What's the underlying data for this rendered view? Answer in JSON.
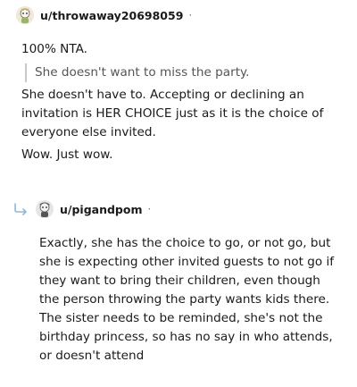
{
  "comment1": {
    "username": "u/throwaway20698059",
    "separator": "·",
    "paragraph1": "100% NTA.",
    "quote": "She doesn't want to miss the party.",
    "paragraph2": "She doesn't have to. Accepting or declining an invitation is HER CHOICE just as it is the choice of everyone else invited.",
    "paragraph3": "Wow. Just wow."
  },
  "comment2": {
    "username": "u/pigandpom",
    "separator": "·",
    "paragraph1": "Exactly, she has the choice to go, or not go, but she is expecting other invited guests to not go if they want to bring their children, even though the person throwing the party wants kids there. The sister needs to be reminded, she's not the birthday princess, so has no say in who attends, or doesn't attend"
  },
  "colors": {
    "username": "#1a1a1b",
    "meta": "#787c7e",
    "quote_bar": "#c8c8c8",
    "reply_arrow": "#8fb7d8"
  },
  "icons": {
    "avatar1": "snoo-avatar-icon",
    "avatar2": "snoo-avatar-icon",
    "reply": "reply-arrow-icon"
  }
}
